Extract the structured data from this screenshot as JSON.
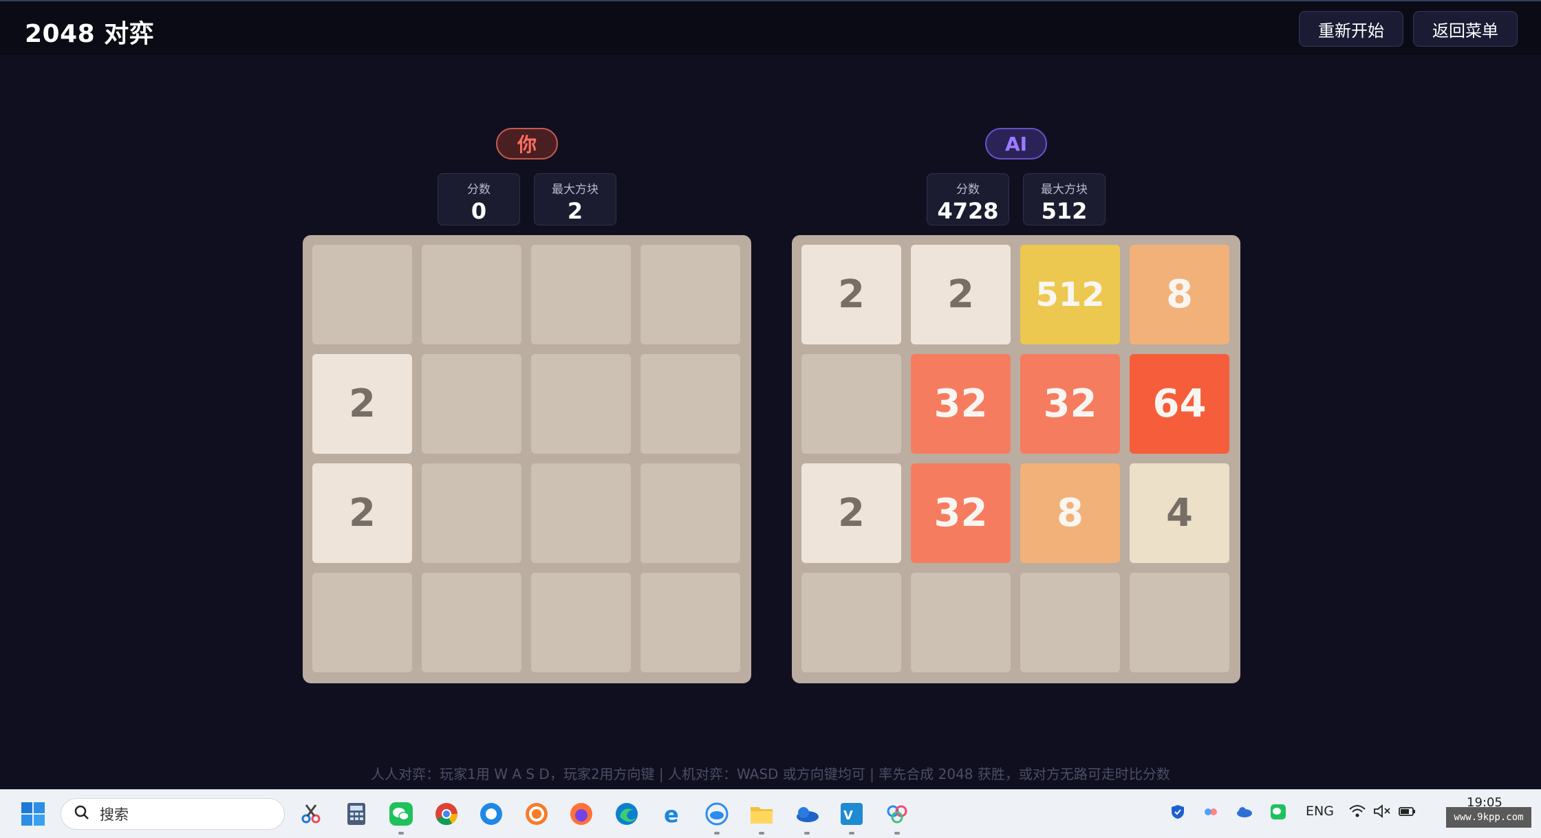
{
  "header": {
    "title": "2048 对弈",
    "restart_label": "重新开始",
    "back_label": "返回菜单"
  },
  "players": {
    "you": {
      "name": "你",
      "score_label": "分数",
      "score": "0",
      "max_label": "最大方块",
      "max_tile": "2",
      "grid": [
        [
          "",
          "",
          "",
          ""
        ],
        [
          "2",
          "",
          "",
          ""
        ],
        [
          "2",
          "",
          "",
          ""
        ],
        [
          "",
          "",
          "",
          ""
        ]
      ]
    },
    "ai": {
      "name": "AI",
      "score_label": "分数",
      "score": "4728",
      "max_label": "最大方块",
      "max_tile": "512",
      "grid": [
        [
          "2",
          "2",
          "512",
          "8"
        ],
        [
          "",
          "32",
          "32",
          "64"
        ],
        [
          "2",
          "32",
          "8",
          "4"
        ],
        [
          "",
          "",
          "",
          ""
        ]
      ]
    }
  },
  "hint": "人人对弈：玩家1用 W A S D，玩家2用方向键 | 人机对弈：WASD 或方向键均可 | 率先合成 2048 获胜，或对方无路可走时比分数",
  "taskbar": {
    "search_placeholder": "搜索",
    "lang": "ENG",
    "time": "19:05",
    "watermark": "www.9kpp.com",
    "apps": [
      "snipping-tool-icon",
      "calculator-icon",
      "wechat-icon",
      "chrome-icon",
      "browser-icon",
      "360-icon",
      "firefox-icon",
      "edge-icon",
      "ie-icon",
      "cloud-app-icon",
      "file-explorer-icon",
      "onedrive-icon",
      "vscode-icon",
      "baidu-netdisk-icon"
    ]
  },
  "colors": {
    "background": "#0f0f20",
    "board": "#bbada0",
    "empty_tile": "#cdc1b4",
    "you_accent": "#ff7060",
    "ai_accent": "#9d7bff"
  }
}
